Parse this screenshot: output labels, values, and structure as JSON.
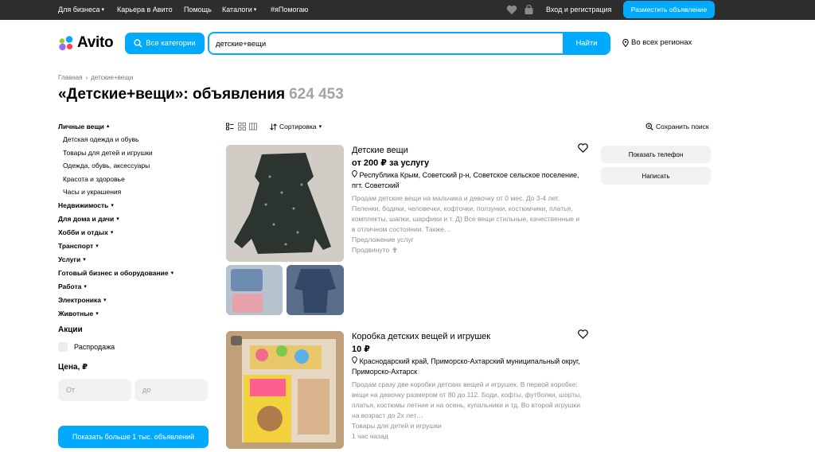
{
  "topbar": {
    "business": "Для бизнеса",
    "career": "Карьера в Авито",
    "help": "Помощь",
    "catalogs": "Каталоги",
    "hashtag": "#яПомогаю",
    "login": "Вход и регистрация",
    "post_ad": "Разместить объявление"
  },
  "header": {
    "logo": "Avito",
    "all_categories": "Все категории",
    "search_value": "детские+вещи",
    "search_button": "Найти",
    "region": "Во всех регионах"
  },
  "breadcrumb": {
    "home": "Главная",
    "separator": "›",
    "current": "детские+вещи"
  },
  "title": {
    "text": "«Детские+вещи»: объявления",
    "count": "624 453"
  },
  "sidebar": {
    "personal": "Личные вещи",
    "subcategories": [
      "Детская одежда и обувь",
      "Товары для детей и игрушки",
      "Одежда, обувь, аксессуары",
      "Красота и здоровье",
      "Часы и украшения"
    ],
    "categories": [
      "Недвижимость",
      "Для дома и дачи",
      "Хобби и отдых",
      "Транспорт",
      "Услуги",
      "Готовый бизнес и оборудование",
      "Работа",
      "Электроника",
      "Животные"
    ],
    "promo_title": "Акции",
    "sale": "Распродажа",
    "price_title": "Цена, ₽",
    "price_from": "От",
    "price_to": "до",
    "show_button": "Показать больше 1 тыс. объявлений"
  },
  "toolbar": {
    "sort": "Сортировка",
    "save_search": "Сохранить поиск"
  },
  "listings": [
    {
      "title": "Детские вещи",
      "price": "от 200 ₽ за услугу",
      "location": "Республика Крым, Советский р-н, Советское сельское поселение, пгт. Советский",
      "description": "Продам детские вещи на мальчика и девочку от 0 мес. До 3-4 лет. Пеленки, бодики, человечки, кофточки, ползунки, костюмчики, платья, комплекты, шапки, шарфики и т. Д) Все вещи стильные, качественные и в отличном состоянии. Также…",
      "category": "Предложение услуг",
      "status": "Продвинуто"
    },
    {
      "title": "Коробка детских вещей и игрушек",
      "price": "10 ₽",
      "location": "Краснодарский край, Приморско-Ахтарский муниципальный округ, Приморско-Ахтарск",
      "description": "Продам сразу две коробки детских вещей и игрушек. В первой коробке: вещи на девочку размером от 80 до 112. Боди, кофты, футболки, шорты, платья, костюмы летние и на осень, купальники и тд. Во второй игрушки на возраст до 2х лет…",
      "category": "Товары для детей и игрушки",
      "status": "1 час назад"
    }
  ],
  "actions": {
    "show_phone": "Показать телефон",
    "write": "Написать"
  },
  "colors": {
    "accent": "#00aaff",
    "topbar": "#2d2d2d"
  }
}
